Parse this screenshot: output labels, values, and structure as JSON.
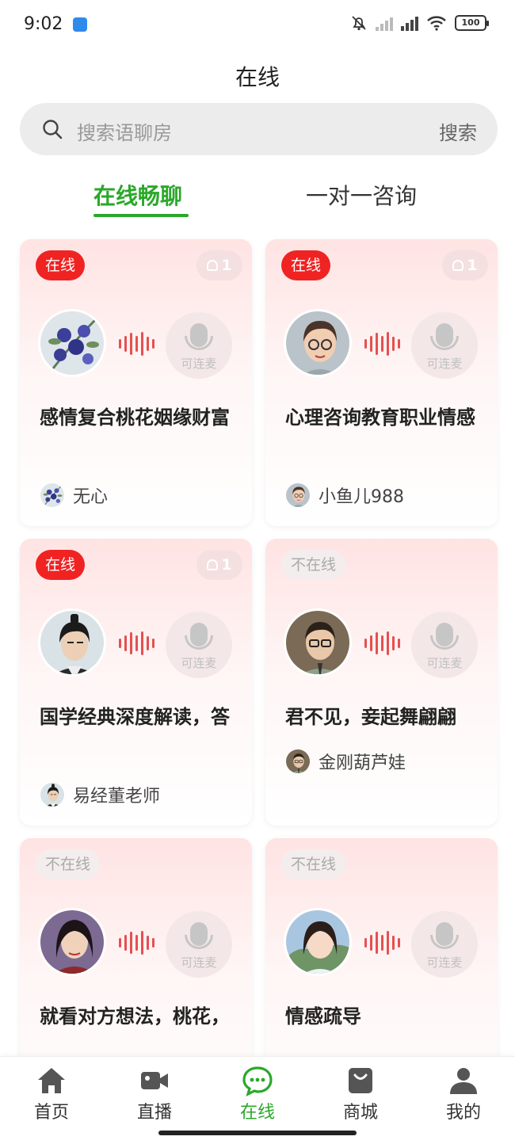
{
  "status_bar": {
    "time": "9:02",
    "battery": "100"
  },
  "header": {
    "title": "在线"
  },
  "search": {
    "placeholder": "搜索语聊房",
    "button": "搜索"
  },
  "tabs": [
    {
      "label": "在线畅聊"
    },
    {
      "label": "一对一咨询"
    }
  ],
  "mic_label": "可连麦",
  "cards": [
    {
      "status": "在线",
      "online": true,
      "count": "1",
      "title": "感情复合桃花姻缘财富",
      "host": "无心",
      "avatar": "flowers"
    },
    {
      "status": "在线",
      "online": true,
      "count": "1",
      "title": "心理咨询教育职业情感",
      "host": "小鱼儿988",
      "avatar": "woman-glasses"
    },
    {
      "status": "在线",
      "online": true,
      "count": "1",
      "title": "国学经典深度解读，答",
      "host": "易经董老师",
      "avatar": "ancient-man"
    },
    {
      "status": "不在线",
      "online": false,
      "count": "",
      "title": "君不见，妾起舞翩翩",
      "host": "金刚葫芦娃",
      "avatar": "man-glasses"
    },
    {
      "status": "不在线",
      "online": false,
      "count": "",
      "title": "就看对方想法，桃花，",
      "host": "",
      "avatar": "ancient-woman"
    },
    {
      "status": "不在线",
      "online": false,
      "count": "",
      "title": "情感疏导",
      "host": "",
      "avatar": "girl"
    }
  ],
  "nav": [
    {
      "label": "首页",
      "icon": "home-icon"
    },
    {
      "label": "直播",
      "icon": "video-icon"
    },
    {
      "label": "在线",
      "icon": "chat-icon",
      "active": true
    },
    {
      "label": "商城",
      "icon": "shop-bag-icon"
    },
    {
      "label": "我的",
      "icon": "user-icon"
    }
  ],
  "colors": {
    "accent": "#2aa82a",
    "online_badge": "#f02323",
    "card_top": "#ffe3e3"
  }
}
